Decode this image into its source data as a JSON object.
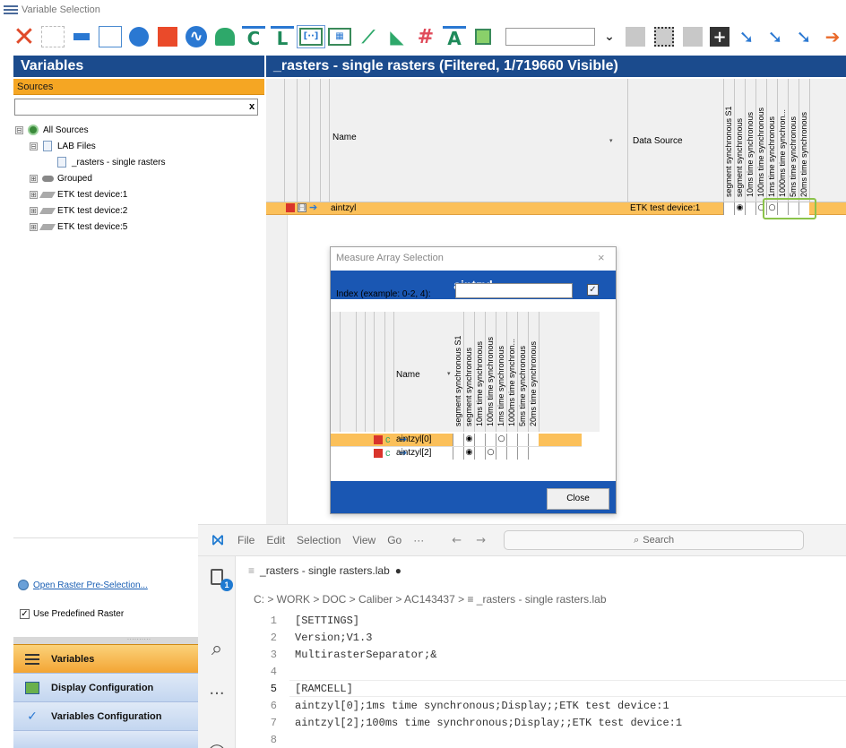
{
  "window": {
    "title": "Variable Selection"
  },
  "left": {
    "header": "Variables",
    "sources_label": "Sources",
    "search_clear": "x",
    "tree": [
      {
        "label": "All Sources",
        "level": 0,
        "toggle": "⊟",
        "icon": "all-sources-icon"
      },
      {
        "label": "LAB Files",
        "level": 1,
        "toggle": "⊟",
        "icon": "file-icon"
      },
      {
        "label": "_rasters - single rasters",
        "level": 2,
        "toggle": "",
        "icon": "file-icon"
      },
      {
        "label": "Grouped",
        "level": 1,
        "toggle": "⊞",
        "icon": "group-icon"
      },
      {
        "label": "ETK test device:1",
        "level": 1,
        "toggle": "⊞",
        "icon": "device-icon"
      },
      {
        "label": "ETK test device:2",
        "level": 1,
        "toggle": "⊞",
        "icon": "device-icon"
      },
      {
        "label": "ETK test device:5",
        "level": 1,
        "toggle": "⊞",
        "icon": "device-icon"
      }
    ],
    "raster_link": "Open Raster Pre-Selection...",
    "use_raster_label": "Use Predefined Raster",
    "use_raster_checked": "✓",
    "grip": "··········",
    "nav": {
      "variables": "Variables",
      "display": "Display Configuration",
      "varcfg": "Variables Configuration"
    }
  },
  "right": {
    "header": "_rasters - single rasters (Filtered, 1/719660 Visible)",
    "col_name": "Name",
    "col_ds": "Data Source",
    "sort_mark": "▾",
    "raster_cols": [
      "segment synchronous S1",
      "segment synchronous",
      "10ms time synchronous",
      "100ms time synchronous",
      "1ms time synchronous",
      "1000ms time synchron...",
      "5ms time synchronous",
      "20ms time synchronous"
    ],
    "row": {
      "name": "aintzyl",
      "ds": "ETK test device:1",
      "cells": [
        "",
        "◉",
        "",
        "○",
        "○",
        "",
        "",
        ""
      ]
    }
  },
  "dialog": {
    "title": "Measure Array Selection",
    "close_x": "×",
    "heading": "aintzyl",
    "index_label": "Index (example: 0-2, 4):",
    "index_value": "",
    "index_btn": "✓",
    "col_name": "Name",
    "sort_mark": "▾",
    "raster_cols": [
      "segment synchronous S1",
      "segment synchronous",
      "10ms time synchronous",
      "100ms time synchronous",
      "1ms time synchronous",
      "1000ms time synchron...",
      "5ms time synchronous",
      "20ms time synchronous"
    ],
    "rows": [
      {
        "name": "aintzyl[0]",
        "cells": [
          "",
          "◉",
          "",
          "",
          "○",
          "",
          "",
          ""
        ]
      },
      {
        "name": "aintzyl[2]",
        "cells": [
          "",
          "◉",
          "",
          "○",
          "",
          "",
          "",
          ""
        ]
      }
    ],
    "close_label": "Close"
  },
  "editor": {
    "menu": [
      "File",
      "Edit",
      "Selection",
      "View",
      "Go",
      "···"
    ],
    "nav_arrows": "← →",
    "search_placeholder": "Search",
    "badge": "1",
    "tab_icon": "≡",
    "tab_label": "_rasters - single rasters.lab",
    "tab_dirty": "●",
    "breadcrumb": "C: > WORK > DOC > Caliber > AC143437 > ≡ _rasters - single rasters.lab",
    "lines": [
      {
        "n": "1",
        "text": "[SETTINGS]"
      },
      {
        "n": "2",
        "text": "Version;V1.3"
      },
      {
        "n": "3",
        "text": "MultirasterSeparator;&"
      },
      {
        "n": "4",
        "text": ""
      },
      {
        "n": "5",
        "text": "[RAMCELL]"
      },
      {
        "n": "6",
        "text": "aintzyl[0];1ms time synchronous;Display;;ETK test device:1"
      },
      {
        "n": "7",
        "text": "aintzyl[2];100ms time synchronous;Display;;ETK test device:1"
      },
      {
        "n": "8",
        "text": ""
      }
    ]
  }
}
